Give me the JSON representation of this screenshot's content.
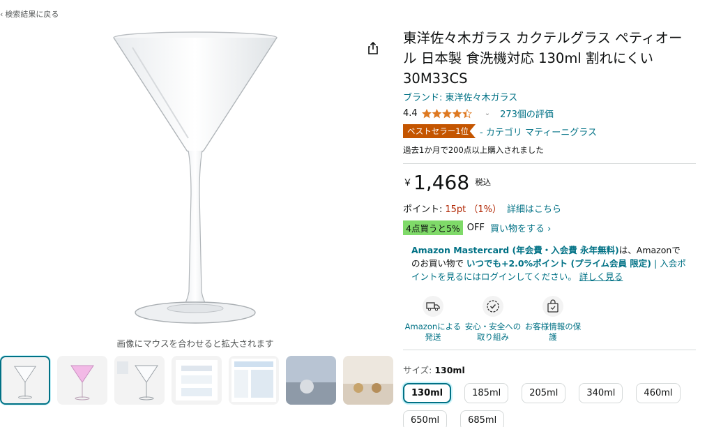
{
  "nav": {
    "back_label": "検索結果に戻る"
  },
  "gallery": {
    "hover_hint": "画像にマウスを合わせると拡大されます",
    "thumbnails": [
      "glass-front",
      "glass-pink",
      "glass-info",
      "feature-sheet",
      "certification-sheet",
      "lifestyle-table",
      "lifestyle-dinner"
    ]
  },
  "product": {
    "title": "東洋佐々木ガラス カクテルグラス ペティオール 日本製 食洗機対応 130ml 割れにくい 30M33CS",
    "brand": "ブランド: 東洋佐々木ガラス",
    "rating": "4.4",
    "rating_count": "273個の評価",
    "bestseller_badge": "ベストセラー1位",
    "bestseller_category": "- カテゴリ マティーニグラス",
    "bought_text": "過去1か月で200点以上購入されました",
    "price_symbol": "￥",
    "price": "1,468",
    "tax_label": "税込",
    "points_label": "ポイント:",
    "points_value": "15pt （1%）",
    "points_link": "詳細はこちら",
    "promo_badge": "4点買うと5%",
    "promo_off": "OFF",
    "promo_link": "買い物をする ›",
    "card_title": "Amazon Mastercard (年会費・入会費 永年無料)",
    "card_text1": "は、Amazonでのお買い物で",
    "card_bold": "いつでも+2.0%ポイント (プライム会員 限定)",
    "card_text2": "| 入会ポイントを見るにはログインしてください。",
    "card_link": "詳しく見る",
    "features": [
      {
        "label": "Amazonによる発送",
        "icon": "truck-icon"
      },
      {
        "label": "安心・安全への取り組み",
        "icon": "shield-check-icon"
      },
      {
        "label": "お客様情報の保護",
        "icon": "lock-bag-icon"
      }
    ],
    "size_label": "サイズ:",
    "size_selected": "130ml",
    "sizes": [
      "130ml",
      "185ml",
      "205ml",
      "340ml",
      "460ml",
      "650ml",
      "685ml"
    ]
  },
  "colors": {
    "link": "#007185",
    "bestseller": "#c45500",
    "promo": "#7fda69",
    "star": "#de7921"
  }
}
